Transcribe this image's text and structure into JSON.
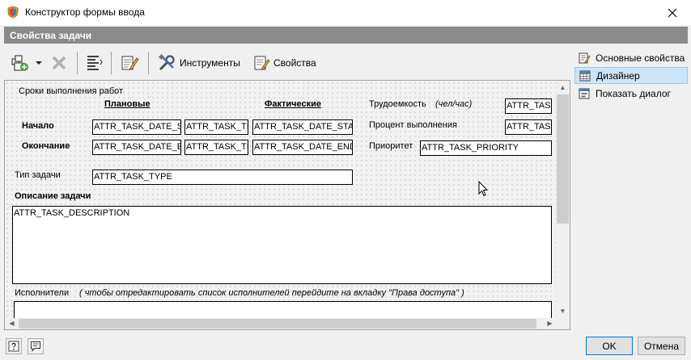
{
  "window": {
    "title": "Конструктор формы ввода",
    "close_glyph": "✕"
  },
  "panel": {
    "header": "Свойства задачи"
  },
  "toolbar": {
    "add_icon": "add-element-icon",
    "delete_icon": "delete-icon",
    "tools_label": "Инструменты",
    "properties_label": "Свойства"
  },
  "form": {
    "section_title": "Сроки выполнения работ",
    "col_planned": "Плановые",
    "col_actual": "Фактические",
    "row_start": "Начало",
    "row_end": "Окончание",
    "planned_start_date": "ATTR_TASK_DATE_START",
    "planned_start_time": "ATTR_TASK_TIME_START",
    "actual_start_date": "ATTR_TASK_DATE_START_FACT",
    "planned_end_date": "ATTR_TASK_DATE_END",
    "planned_end_time": "ATTR_TASK_TIME_END",
    "actual_end_date": "ATTR_TASK_DATE_END_FACT",
    "labor_label": "Трудоемкость",
    "labor_unit": "(чел/час)",
    "labor_field": "ATTR_TASK_LABOR",
    "percent_label": "Процент выполнения",
    "percent_field": "ATTR_TASK_PERCENT",
    "priority_label": "Приоритет",
    "priority_field": "ATTR_TASK_PRIORITY",
    "type_label": "Тип задачи",
    "type_field": "ATTR_TASK_TYPE",
    "description_label": "Описание задачи",
    "description_field": "ATTR_TASK_DESCRIPTION",
    "executors_label": "Исполнители",
    "executors_hint": "( чтобы отредактировать список исполнителей перейдите на вкладку \"Права доступа\" )"
  },
  "sidepanel": {
    "items": [
      {
        "label": "Основные свойства",
        "icon": "properties-icon"
      },
      {
        "label": "Дизайнер",
        "icon": "designer-grid-icon",
        "selected": true
      },
      {
        "label": "Показать диалог",
        "icon": "dialog-icon"
      }
    ]
  },
  "footer": {
    "help_icon": "help-icon",
    "comment_icon": "comment-icon",
    "ok_label": "OK",
    "cancel_label": "Отмена"
  },
  "colors": {
    "header_bg": "#8a8a8a",
    "selected_bg": "#cce4f7",
    "default_button_border": "#0078d7"
  }
}
